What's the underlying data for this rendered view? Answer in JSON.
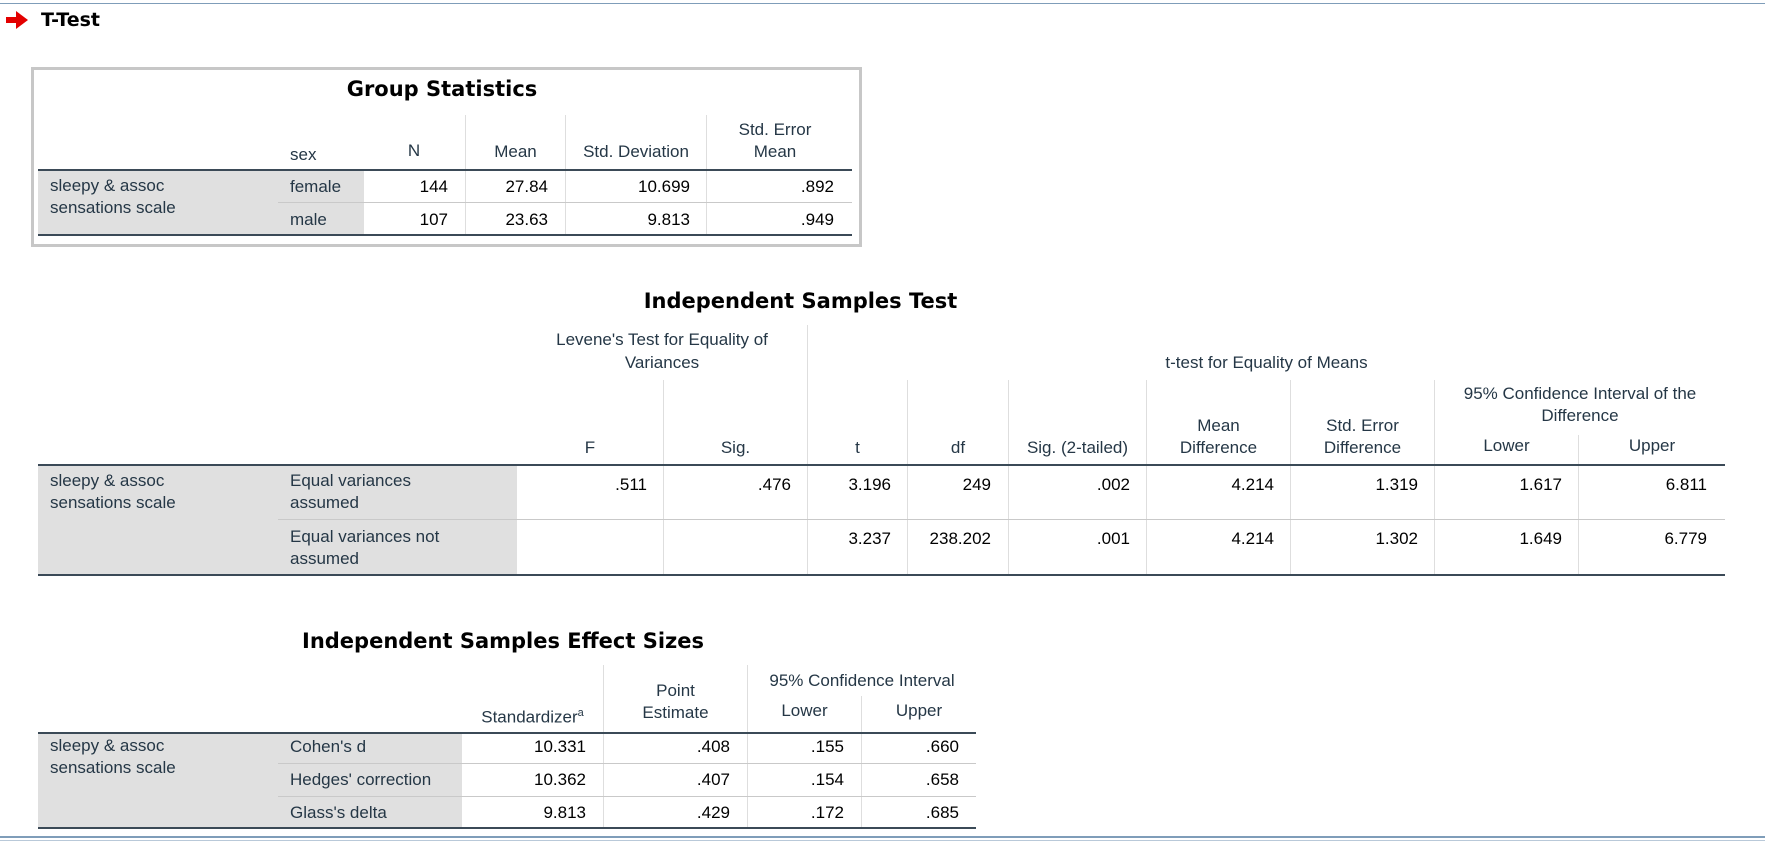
{
  "heading": {
    "title": "T-Test",
    "icon": "red-arrow-icon",
    "icon_color": "#e30000"
  },
  "colors": {
    "label_text": "#253746",
    "shade": "#e0e0e0",
    "rule": "#3b4a57"
  },
  "group_stats": {
    "title": "Group Statistics",
    "headers": [
      "sex",
      "N",
      "Mean",
      "Std. Deviation",
      "Std. Error",
      "Mean"
    ],
    "variable": [
      "sleepy & assoc",
      "sensations scale"
    ],
    "rows": [
      {
        "sex": "female",
        "n": "144",
        "mean": "27.84",
        "sd": "10.699",
        "se": ".892"
      },
      {
        "sex": "male",
        "n": "107",
        "mean": "23.63",
        "sd": "9.813",
        "se": ".949"
      }
    ]
  },
  "ind_test": {
    "title": "Independent Samples Test",
    "levene_header": [
      "Levene's Test for Equality of",
      "Variances"
    ],
    "ttest_header": "t-test for Equality of Means",
    "ci_header": [
      "95% Confidence Interval of the",
      "Difference"
    ],
    "mean_diff": [
      "Mean",
      "Difference"
    ],
    "se_diff": [
      "Std. Error",
      "Difference"
    ],
    "cols": [
      "F",
      "Sig.",
      "t",
      "df",
      "Sig. (2-tailed)",
      "Lower",
      "Upper"
    ],
    "variable": [
      "sleepy & assoc",
      "sensations scale"
    ],
    "rows": [
      {
        "label": [
          "Equal variances",
          "assumed"
        ],
        "F": ".511",
        "sig": ".476",
        "t": "3.196",
        "df": "249",
        "sig2": ".002",
        "md": "4.214",
        "sed": "1.319",
        "lower": "1.617",
        "upper": "6.811"
      },
      {
        "label": [
          "Equal variances not",
          "assumed"
        ],
        "F": "",
        "sig": "",
        "t": "3.237",
        "df": "238.202",
        "sig2": ".001",
        "md": "4.214",
        "sed": "1.302",
        "lower": "1.649",
        "upper": "6.779"
      }
    ]
  },
  "effect": {
    "title": "Independent Samples Effect Sizes",
    "standardizer": "Standardizer",
    "sup": "a",
    "point": [
      "Point",
      "Estimate"
    ],
    "ci": "95% Confidence Interval",
    "lower": "Lower",
    "upper": "Upper",
    "variable": [
      "sleepy & assoc",
      "sensations scale"
    ],
    "rows": [
      {
        "label": "Cohen's d",
        "std": "10.331",
        "pe": ".408",
        "lower": ".155",
        "upper": ".660"
      },
      {
        "label": "Hedges' correction",
        "std": "10.362",
        "pe": ".407",
        "lower": ".154",
        "upper": ".658"
      },
      {
        "label": "Glass's delta",
        "std": "9.813",
        "pe": ".429",
        "lower": ".172",
        "upper": ".685"
      }
    ]
  }
}
